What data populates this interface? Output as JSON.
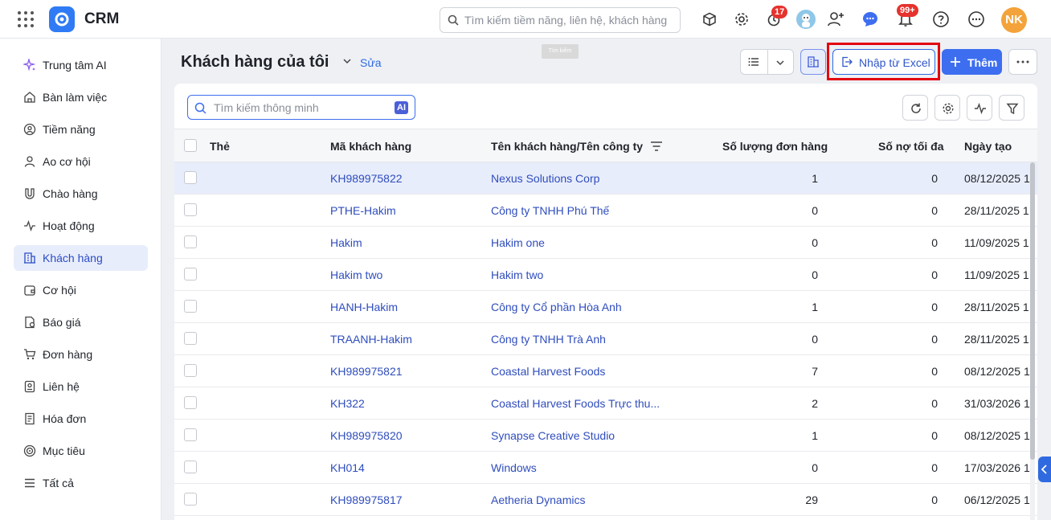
{
  "header": {
    "app_name": "CRM",
    "search_placeholder": "Tìm kiếm tiềm năng, liên hệ, khách hàng",
    "reminder_badge": "17",
    "notification_badge": "99+",
    "user_initials": "NK",
    "accent_color": "#3d6ef0",
    "badge_color": "#e5322d",
    "avatar_color": "#f3a33a"
  },
  "sidebar": {
    "items": [
      {
        "label": "Trung tâm AI",
        "icon": "sparkle-icon"
      },
      {
        "label": "Bàn làm việc",
        "icon": "home-icon"
      },
      {
        "label": "Tiềm năng",
        "icon": "user-circle-icon"
      },
      {
        "label": "Ao cơ hội",
        "icon": "user-icon"
      },
      {
        "label": "Chào hàng",
        "icon": "magnet-icon"
      },
      {
        "label": "Hoạt động",
        "icon": "activity-icon"
      },
      {
        "label": "Khách hàng",
        "icon": "building-icon",
        "active": true
      },
      {
        "label": "Cơ hội",
        "icon": "wallet-icon"
      },
      {
        "label": "Báo giá",
        "icon": "quote-icon"
      },
      {
        "label": "Đơn hàng",
        "icon": "cart-icon"
      },
      {
        "label": "Liên hệ",
        "icon": "contact-icon"
      },
      {
        "label": "Hóa đơn",
        "icon": "invoice-icon"
      },
      {
        "label": "Mục tiêu",
        "icon": "target-icon"
      },
      {
        "label": "Tất cả",
        "icon": "menu-icon"
      }
    ]
  },
  "main": {
    "title": "Khách hàng của tôi",
    "edit_label": "Sửa",
    "tooltip": "Tìm kiếm",
    "import_label": "Nhập từ Excel",
    "add_label": "Thêm",
    "smart_search_placeholder": "Tìm kiếm thông minh",
    "ai_label": "AI"
  },
  "table": {
    "columns": [
      "Thẻ",
      "Mã khách hàng",
      "Tên khách hàng/Tên công ty",
      "Số lượng đơn hàng",
      "Số nợ tối đa",
      "Ngày tạo"
    ],
    "rows": [
      {
        "code": "KH989975822",
        "name": "Nexus Solutions Corp",
        "orders": "1",
        "debt": "0",
        "date": "08/12/2025 1",
        "selected": true
      },
      {
        "code": "PTHE-Hakim",
        "name": "Công ty TNHH Phú Thế",
        "orders": "0",
        "debt": "0",
        "date": "28/11/2025 1"
      },
      {
        "code": "Hakim",
        "name": "Hakim one",
        "orders": "0",
        "debt": "0",
        "date": "11/09/2025 1"
      },
      {
        "code": "Hakim two",
        "name": "Hakim two",
        "orders": "0",
        "debt": "0",
        "date": "11/09/2025 1"
      },
      {
        "code": "HANH-Hakim",
        "name": "Công ty Cổ phần Hòa Anh",
        "orders": "1",
        "debt": "0",
        "date": "28/11/2025 1"
      },
      {
        "code": "TRAANH-Hakim",
        "name": "Công ty TNHH Trà Anh",
        "orders": "0",
        "debt": "0",
        "date": "28/11/2025 1"
      },
      {
        "code": "KH989975821",
        "name": "Coastal Harvest Foods",
        "orders": "7",
        "debt": "0",
        "date": "08/12/2025 1"
      },
      {
        "code": "KH322",
        "name": "Coastal Harvest Foods Trực thu...",
        "orders": "2",
        "debt": "0",
        "date": "31/03/2026 1"
      },
      {
        "code": "KH989975820",
        "name": "Synapse Creative Studio",
        "orders": "1",
        "debt": "0",
        "date": "08/12/2025 1"
      },
      {
        "code": "KH014",
        "name": "Windows",
        "orders": "0",
        "debt": "0",
        "date": "17/03/2026 1"
      },
      {
        "code": "KH989975817",
        "name": "Aetheria Dynamics",
        "orders": "29",
        "debt": "0",
        "date": "06/12/2025 1"
      }
    ]
  }
}
